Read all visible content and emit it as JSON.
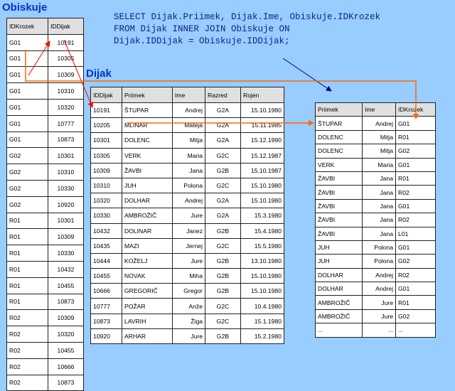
{
  "titles": {
    "obiskuje": "Obiskuje",
    "dijak": "Dijak"
  },
  "sql": [
    "SELECT Dijak.Priimek, Dijak.Ime, Obiskuje.IDKrozek",
    "FROM Dijak INNER JOIN Obiskuje ON",
    "Dijak.IDDijak = Obiskuje.IDDijak;"
  ],
  "obiskuje": {
    "headers": [
      "IDKrozek",
      "IDDijak"
    ],
    "rows": [
      [
        "G01",
        "10191"
      ],
      [
        "G01",
        "10305"
      ],
      [
        "G01",
        "10309"
      ],
      [
        "G01",
        "10310"
      ],
      [
        "G01",
        "10320"
      ],
      [
        "G01",
        "10777"
      ],
      [
        "G01",
        "10873"
      ],
      [
        "G02",
        "10301"
      ],
      [
        "G02",
        "10310"
      ],
      [
        "G02",
        "10330"
      ],
      [
        "G02",
        "10920"
      ],
      [
        "R01",
        "10301"
      ],
      [
        "R01",
        "10309"
      ],
      [
        "R01",
        "10330"
      ],
      [
        "R01",
        "10432"
      ],
      [
        "R01",
        "10455"
      ],
      [
        "R01",
        "10873"
      ],
      [
        "R02",
        "10309"
      ],
      [
        "R02",
        "10320"
      ],
      [
        "R02",
        "10455"
      ],
      [
        "R02",
        "10666"
      ],
      [
        "R02",
        "10873"
      ]
    ]
  },
  "dijak": {
    "headers": [
      "IDDijak",
      "Priimek",
      "Ime",
      "Razred",
      "Rojen"
    ],
    "rows": [
      [
        "10191",
        "ŠTUPAR",
        "Andrej",
        "G2A",
        "15.10.1980"
      ],
      [
        "10205",
        "MLINAR",
        "Mateja",
        "G2A",
        "15.11.1985"
      ],
      [
        "10301",
        "DOLENC",
        "Mitja",
        "G2A",
        "15.12.1990"
      ],
      [
        "10305",
        "VERK",
        "Maria",
        "G2C",
        "15.12.1987"
      ],
      [
        "10309",
        "ŽAVBI",
        "Jana",
        "G2B",
        "15.10.1987"
      ],
      [
        "10310",
        "JUH",
        "Polona",
        "G2C",
        "15.10.1980"
      ],
      [
        "10320",
        "DOLHAR",
        "Andrej",
        "G2A",
        "15.10.1980"
      ],
      [
        "10330",
        "AMBROŽIČ",
        "Jure",
        "G2A",
        "15.3.1980"
      ],
      [
        "10432",
        "DOLINAR",
        "Janez",
        "G2B",
        "15.4.1980"
      ],
      [
        "10435",
        "MAZI",
        "Jernej",
        "G2C",
        "15.5.1980"
      ],
      [
        "10444",
        "KOŽELJ",
        "Jure",
        "G2B",
        "13.10.1980"
      ],
      [
        "10455",
        "NOVAK",
        "Miha",
        "G2B",
        "15.10.1980"
      ],
      [
        "10666",
        "GREGORIČ",
        "Gregor",
        "G2B",
        "15.10.1980"
      ],
      [
        "10777",
        "POŽAR",
        "Anže",
        "G2C",
        "10.4.1980"
      ],
      [
        "10873",
        "LAVRIH",
        "Žiga",
        "G2C",
        "15.1.1980"
      ],
      [
        "10920",
        "ARHAR",
        "Jure",
        "G2B",
        "15.2.1980"
      ]
    ]
  },
  "result": {
    "headers": [
      "Priimek",
      "Ime",
      "IDKrozek"
    ],
    "rows": [
      [
        "ŠTUPAR",
        "Andrej",
        "G01"
      ],
      [
        "DOLENC",
        "Mitja",
        "R01"
      ],
      [
        "DOLENC",
        "Mitja",
        "G02"
      ],
      [
        "VERK",
        "Maria",
        "G01"
      ],
      [
        "ŽAVBI",
        "Jana",
        "R01"
      ],
      [
        "ŽAVBI",
        "Jana",
        "R02"
      ],
      [
        "ŽAVBI",
        "Jana",
        "G01"
      ],
      [
        "ŽAVBI",
        "Jana",
        "R02"
      ],
      [
        "ŽAVBI",
        "Jana",
        "L01"
      ],
      [
        "JUH",
        "Polona",
        "G01"
      ],
      [
        "JUH",
        "Polona",
        "G02"
      ],
      [
        "DOLHAR",
        "Andrej",
        "R02"
      ],
      [
        "DOLHAR",
        "Andrej",
        "G01"
      ],
      [
        "AMBROŽIČ",
        "Jure",
        "R01"
      ],
      [
        "AMBROŽIČ",
        "Jure",
        "G02"
      ],
      [
        "...",
        "...",
        "..."
      ]
    ]
  },
  "colors": {
    "background": "#99ccff",
    "title": "#0033cc",
    "arrow_red": "#ff0000",
    "arrow_orange": "#ff6600",
    "arrow_blue": "#000080"
  }
}
